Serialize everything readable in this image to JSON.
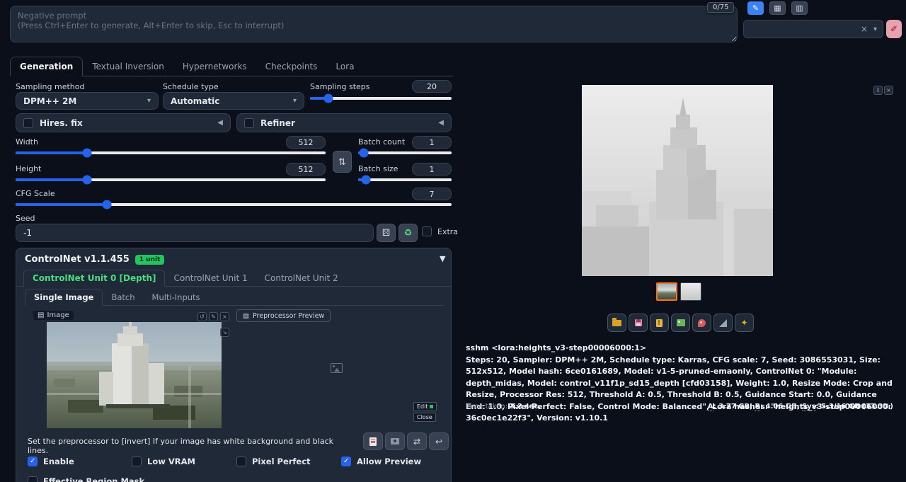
{
  "top": {
    "negative_prompt_placeholder": "Negative prompt\n(Press Ctrl+Enter to generate, Alt+Enter to skip, Esc to interrupt)",
    "token_counter": "0/75"
  },
  "icons": {
    "pencil": "✎",
    "grid": "▦",
    "clipboard": "▥",
    "close": "×",
    "caret": "▾",
    "brush": "✐",
    "collapse_left": "◀",
    "collapse_down": "▼",
    "swap": "⇅",
    "dice": "⚄",
    "recycle": "♻",
    "undo": "↺",
    "expand": "↘",
    "panel": "▤",
    "swap_h": "⇄",
    "back": "↩",
    "download": "⇩",
    "sparkle": "✦"
  },
  "tabs": [
    {
      "label": "Generation"
    },
    {
      "label": "Textual Inversion"
    },
    {
      "label": "Hypernetworks"
    },
    {
      "label": "Checkpoints"
    },
    {
      "label": "Lora"
    }
  ],
  "generation": {
    "sampling_method_label": "Sampling method",
    "sampling_method_value": "DPM++ 2M",
    "schedule_type_label": "Schedule type",
    "schedule_type_value": "Automatic",
    "sampling_steps_label": "Sampling steps",
    "sampling_steps_value": "20",
    "hires_fix_label": "Hires. fix",
    "refiner_label": "Refiner",
    "width_label": "Width",
    "width_value": "512",
    "height_label": "Height",
    "height_value": "512",
    "batch_count_label": "Batch count",
    "batch_count_value": "1",
    "batch_size_label": "Batch size",
    "batch_size_value": "1",
    "cfg_label": "CFG Scale",
    "cfg_value": "7",
    "seed_label": "Seed",
    "seed_value": "-1",
    "extra_label": "Extra"
  },
  "controlnet": {
    "title": "ControlNet v1.1.455",
    "badge": "1 unit",
    "unit_tabs": [
      "ControlNet Unit 0 [Depth]",
      "ControlNet Unit 1",
      "ControlNet Unit 2"
    ],
    "input_tabs": [
      "Single Image",
      "Batch",
      "Multi-Inputs"
    ],
    "image_label": "Image",
    "preprocessor_preview_label": "Preprocessor Preview",
    "edit_label": "Edit",
    "close_label": "Close",
    "hint": "Set the preprocessor to [invert] If your image has white background and black lines.",
    "checkboxes": [
      {
        "label": "Enable",
        "checked": true
      },
      {
        "label": "Low VRAM",
        "checked": false
      },
      {
        "label": "Pixel Perfect",
        "checked": false
      },
      {
        "label": "Allow Preview",
        "checked": true
      }
    ],
    "effective_region_label": "Effective Region Mask"
  },
  "output": {
    "prompt_line": "sshm <lora:heights_v3-step00006000:1>",
    "params_line": "Steps: 20, Sampler: DPM++ 2M, Schedule type: Karras, CFG scale: 7, Seed: 3086553031, Size: 512x512, Model hash: 6ce0161689, Model: v1-5-pruned-emaonly, ControlNet 0: \"Module: depth_midas, Model: control_v11f1p_sd15_depth [cfd03158], Weight: 1.0, Resize Mode: Crop and Resize, Processor Res: 512, Threshold A: 0.5, Threshold B: 0.5, Guidance Start: 0.0, Guidance End: 1.0, Pixel Perfect: False, Control Mode: Balanced\", Lora hashes: \"heights_v3-step00006000: 36c0ec1e22f3\", Version: v1.10.1",
    "time_label": "Time taken:",
    "time_value": "3.2 sec.",
    "memory": {
      "a_label": "A",
      "a_value": ": 3.77 GB, ",
      "r_label": "R",
      "r_value": ": 4.06 GB, ",
      "sys_label": "Sys",
      "sys_value": ": 5.3/16 GB (33.3%)"
    }
  }
}
